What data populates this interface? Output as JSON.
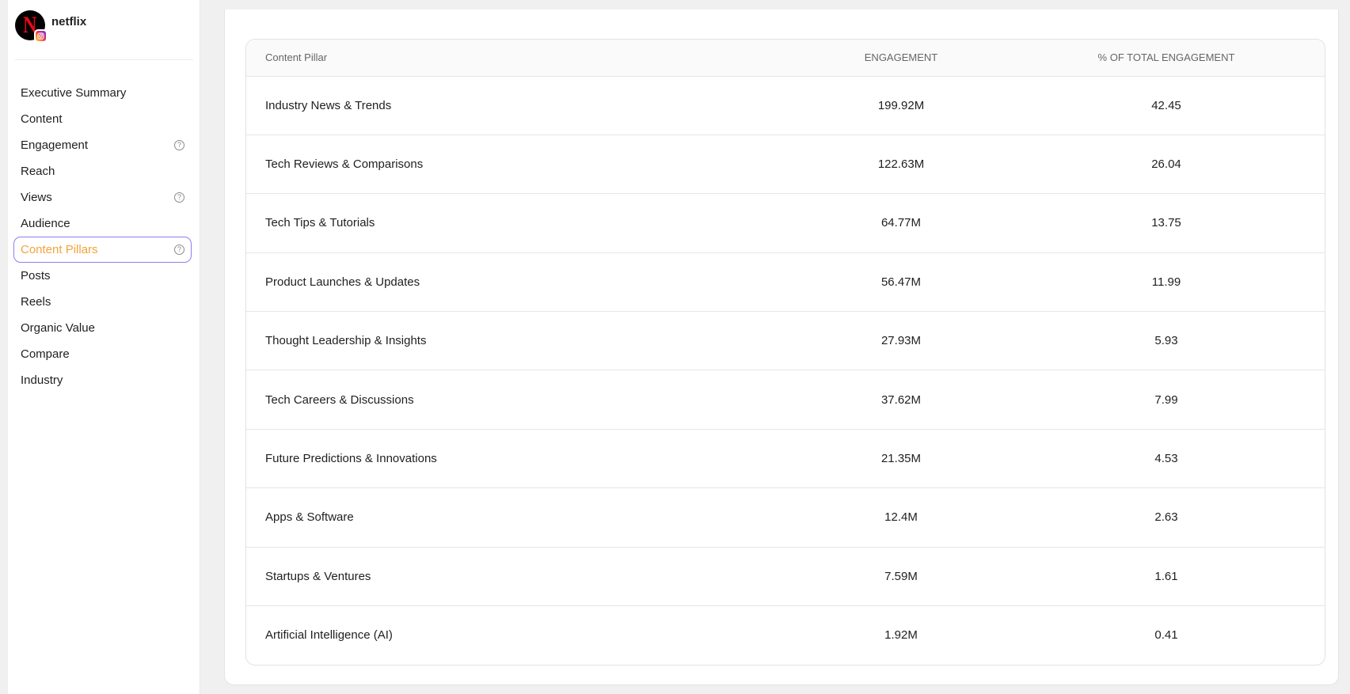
{
  "account": {
    "name": "netflix",
    "avatar_letter": "N",
    "brand_color": "#e50914"
  },
  "sidebar": {
    "items": [
      {
        "label": "Executive Summary",
        "help": false
      },
      {
        "label": "Content",
        "help": false
      },
      {
        "label": "Engagement",
        "help": true
      },
      {
        "label": "Reach",
        "help": false
      },
      {
        "label": "Views",
        "help": true
      },
      {
        "label": "Audience",
        "help": false
      },
      {
        "label": "Content Pillars",
        "help": true,
        "active": true
      },
      {
        "label": "Posts",
        "help": false
      },
      {
        "label": "Reels",
        "help": false
      },
      {
        "label": "Organic Value",
        "help": false
      },
      {
        "label": "Compare",
        "help": false
      },
      {
        "label": "Industry",
        "help": false
      }
    ],
    "help_glyph": "?",
    "active_color": "#f2a43a",
    "active_border": "#8b80f0"
  },
  "table": {
    "headers": {
      "pillar": "Content Pillar",
      "engagement": "ENGAGEMENT",
      "percent": "% OF TOTAL ENGAGEMENT"
    },
    "rows": [
      {
        "pillar": "Industry News & Trends",
        "engagement": "199.92M",
        "percent": "42.45"
      },
      {
        "pillar": "Tech Reviews & Comparisons",
        "engagement": "122.63M",
        "percent": "26.04"
      },
      {
        "pillar": "Tech Tips & Tutorials",
        "engagement": "64.77M",
        "percent": "13.75"
      },
      {
        "pillar": "Product Launches & Updates",
        "engagement": "56.47M",
        "percent": "11.99"
      },
      {
        "pillar": "Thought Leadership & Insights",
        "engagement": "27.93M",
        "percent": "5.93"
      },
      {
        "pillar": "Tech Careers & Discussions",
        "engagement": "37.62M",
        "percent": "7.99"
      },
      {
        "pillar": "Future Predictions & Innovations",
        "engagement": "21.35M",
        "percent": "4.53"
      },
      {
        "pillar": "Apps & Software",
        "engagement": "12.4M",
        "percent": "2.63"
      },
      {
        "pillar": "Startups & Ventures",
        "engagement": "7.59M",
        "percent": "1.61"
      },
      {
        "pillar": "Artificial Intelligence (AI)",
        "engagement": "1.92M",
        "percent": "0.41"
      }
    ]
  }
}
